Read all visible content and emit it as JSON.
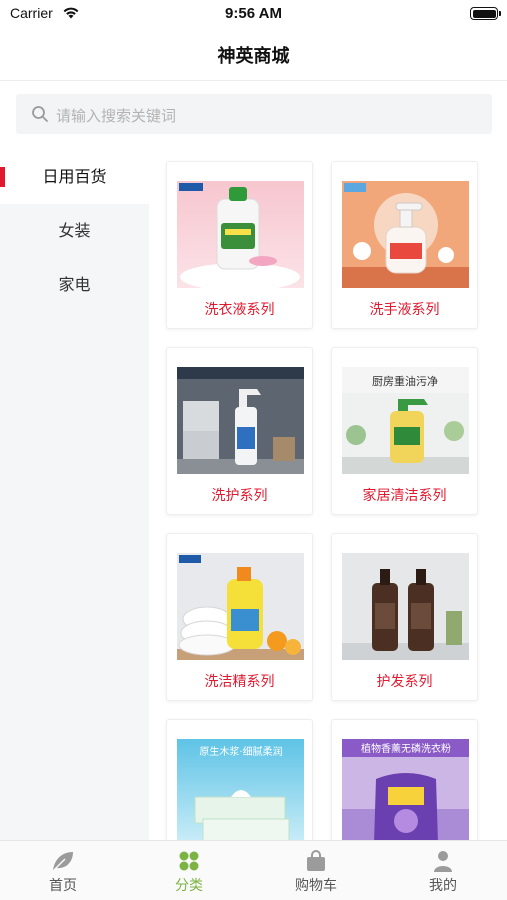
{
  "status_bar": {
    "carrier": "Carrier",
    "time": "9:56 AM"
  },
  "nav": {
    "title": "神英商城"
  },
  "search": {
    "placeholder": "请输入搜索关键词"
  },
  "sidebar": {
    "items": [
      {
        "label": "日用百货",
        "active": true
      },
      {
        "label": "女装",
        "active": false
      },
      {
        "label": "家电",
        "active": false
      }
    ]
  },
  "products": [
    {
      "label": "洗衣液系列"
    },
    {
      "label": "洗手液系列"
    },
    {
      "label": "洗护系列"
    },
    {
      "label": "家居清洁系列"
    },
    {
      "label": "洗洁精系列"
    },
    {
      "label": "护发系列"
    },
    {
      "label": ""
    },
    {
      "label": ""
    }
  ],
  "tabs": [
    {
      "label": "首页",
      "icon": "leaf-icon",
      "active": false
    },
    {
      "label": "分类",
      "icon": "grid-icon",
      "active": true
    },
    {
      "label": "购物车",
      "icon": "bag-icon",
      "active": false
    },
    {
      "label": "我的",
      "icon": "user-icon",
      "active": false
    }
  ],
  "colors": {
    "accent": "#e0192f",
    "tab_active": "#7cb342",
    "sidebar_bg": "#f5f6f8"
  }
}
